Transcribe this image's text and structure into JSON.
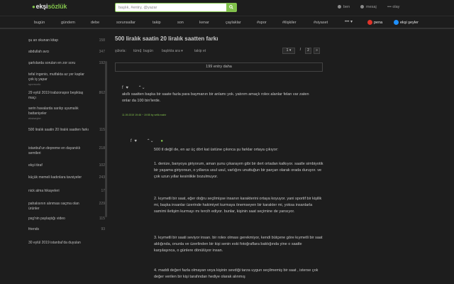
{
  "header": {
    "logo_main": "ekşi",
    "logo_accent": "sözlük",
    "search_placeholder": "başlık, #entry, @yazar",
    "actions": [
      "ben",
      "mesaj",
      "olay"
    ]
  },
  "nav": {
    "items": [
      "bugün",
      "gündem",
      "debe",
      "sorunsallar",
      "takip",
      "son",
      "kenar",
      "çaylaklar",
      "#spor",
      "#ilişkiler",
      "#siyaset"
    ],
    "more": "•••",
    "pena": "pena",
    "seyler": "ekşi şeyler"
  },
  "sidebar": {
    "items": [
      {
        "title": "şu an okunan kitap",
        "count": "158",
        "source": ""
      },
      {
        "title": "abdullah avcı",
        "count": "347",
        "source": ""
      },
      {
        "title": "şarkılarda sorulan en zor soru",
        "count": "192",
        "source": ""
      },
      {
        "title": "tefal ingenio, mutfakta az yer kaplar çok iş yapar",
        "count": "",
        "source": "sponsorlu"
      },
      {
        "title": "29 eylül 2019 trabzonspor beşiktaş maçı",
        "count": "862",
        "source": ""
      },
      {
        "title": "serin havalarda sarılıp uyumalık battaniyeler",
        "count": "",
        "source": "eksiseyler"
      },
      {
        "title": "500 liralık saatin 20 liralık saatten farkı",
        "count": "115",
        "source": ""
      },
      {
        "title": "istanbul'un depreme en dayanıklı semtleri",
        "count": "218",
        "source": ""
      },
      {
        "title": "ekşi itiraf",
        "count": "102",
        "source": ""
      },
      {
        "title": "küçük memeli kadınlara tavsiyeler",
        "count": "243",
        "source": ""
      },
      {
        "title": "nick alma hikayeleri",
        "count": "17",
        "source": ""
      },
      {
        "title": "pahalısının alınması saçma olan ürünler",
        "count": "229",
        "source": ""
      },
      {
        "title": "psg'nin paylaştığı video",
        "count": "115",
        "source": ""
      },
      {
        "title": "friends",
        "count": "93",
        "source": ""
      },
      {
        "title": "30 eylül 2019 istanbul'da duyulan",
        "count": "",
        "source": ""
      }
    ]
  },
  "topic": {
    "title": "500 liralık saatin 20 liralık saatten farkı",
    "meta": [
      "şükela:",
      "tümü",
      "|",
      "bugün",
      "başlıkta ara",
      "takip et"
    ],
    "page_current": "1",
    "page_total": "2",
    "page_next": "»",
    "more_entries": "199 entry daha"
  },
  "entries": [
    {
      "text": "akıllı saatten başka bir saate fazla para baymanın bir anlamı yok. yatırım amaçlı rolex alanlar felan var zaten onlar da 100 bin'lerde.",
      "author": "11.09.2019 19:46 ~ 19:55 by vefik mahir"
    },
    {
      "paragraphs": [
        "500 tl değil de, en az üç dört kat üstüne çıkınca şu farklar ortaya çıkıyor:",
        "1. denize, banyoya giriyorum, aman şunu çıkarayım gibi bir dert ortadan kalkıyor. saatle simbiyotik bir yaşama giriyorsun, o yıllarca usul usul, varlığını unuttuğun bir parçan olarak orada duruyor. ve çok uzun yıllar kesinlikle bozulmuyor.",
        "2. kıymetli bir saat, eğer doğru seçilmişse insanın karakterini ortaya koyuyor. yani sportif bir kişilik mi, başka insanlar üzerinde hakimiyet kurmaya önemseyen bir karakter mi, yoksa insanlarla samimi iletişim kurmayı mı tercih ediyor. bunlar, kişinin saat seçimine de yansıyor.",
        "3. kıymetli bir saati seviyor insan. bir rolex olması gerekmiyor, kendi bütçene göre kıymetli bir saat aldığında, onunla ve üzerlinden bir kişi senin eski fotoğraflara baktığında yine o saatle karşılaşınca, o günlere dönülüyor insan.",
        "4. maddi değeri fazla olmayan veya kişinin sevdiği tarza uygun seçilmemiş bir saat , isterse çok değer verilen bir kişi tarafından hediye olarak alınmış"
      ]
    }
  ],
  "colors": {
    "accent": "#81c14b",
    "background": "#1d1d1d",
    "pena": "#e0342a",
    "seyler": "#1e90ff"
  }
}
